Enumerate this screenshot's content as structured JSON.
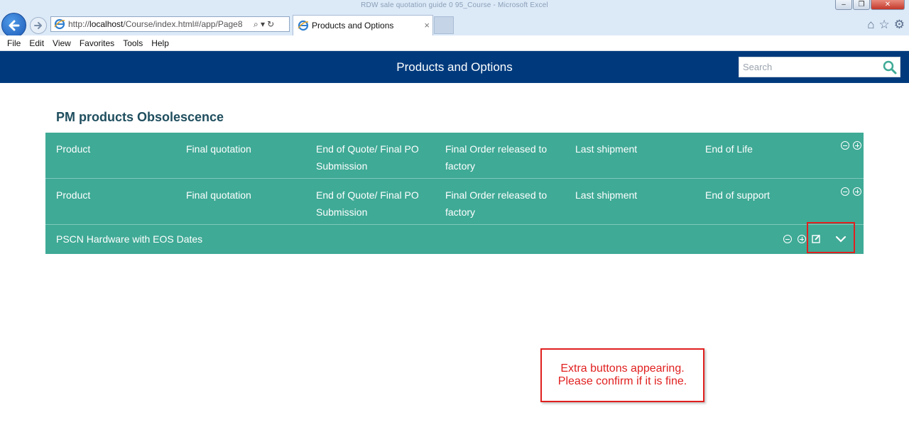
{
  "window": {
    "title": "RDW sale quotation guide 0 95_Course - Microsoft Excel"
  },
  "browser": {
    "address": "http://localhost/Course/index.html#/app/Page8",
    "address_host": "localhost",
    "address_prefix": "http://",
    "address_suffix": "/Course/index.html#/app/Page8",
    "tab_title": "Products and Options",
    "tab_close": "×"
  },
  "menu": {
    "items": [
      "File",
      "Edit",
      "View",
      "Favorites",
      "Tools",
      "Help"
    ]
  },
  "header": {
    "title": "Products and Options",
    "search_placeholder": "Search"
  },
  "section": {
    "title": "PM products Obsolescence"
  },
  "table": {
    "header_rows": [
      [
        "Product",
        "Final quotation",
        "End of Quote/ Final PO Submission",
        "Final Order released to factory",
        "Last shipment",
        "End of Life"
      ],
      [
        "Product",
        "Final quotation",
        "End of Quote/ Final PO Submission",
        "Final Order released to factory",
        "Last shipment",
        "End of support"
      ]
    ],
    "data_row": {
      "label": "PSCN Hardware with EOS Dates"
    }
  },
  "annotation": {
    "line1": "Extra buttons appearing.",
    "line2": "Please confirm if it is fine."
  },
  "colors": {
    "header_bg": "#003a7d",
    "table_bg": "#3faa96",
    "section_title": "#1f4e5e",
    "annotation_red": "#e0201f"
  }
}
